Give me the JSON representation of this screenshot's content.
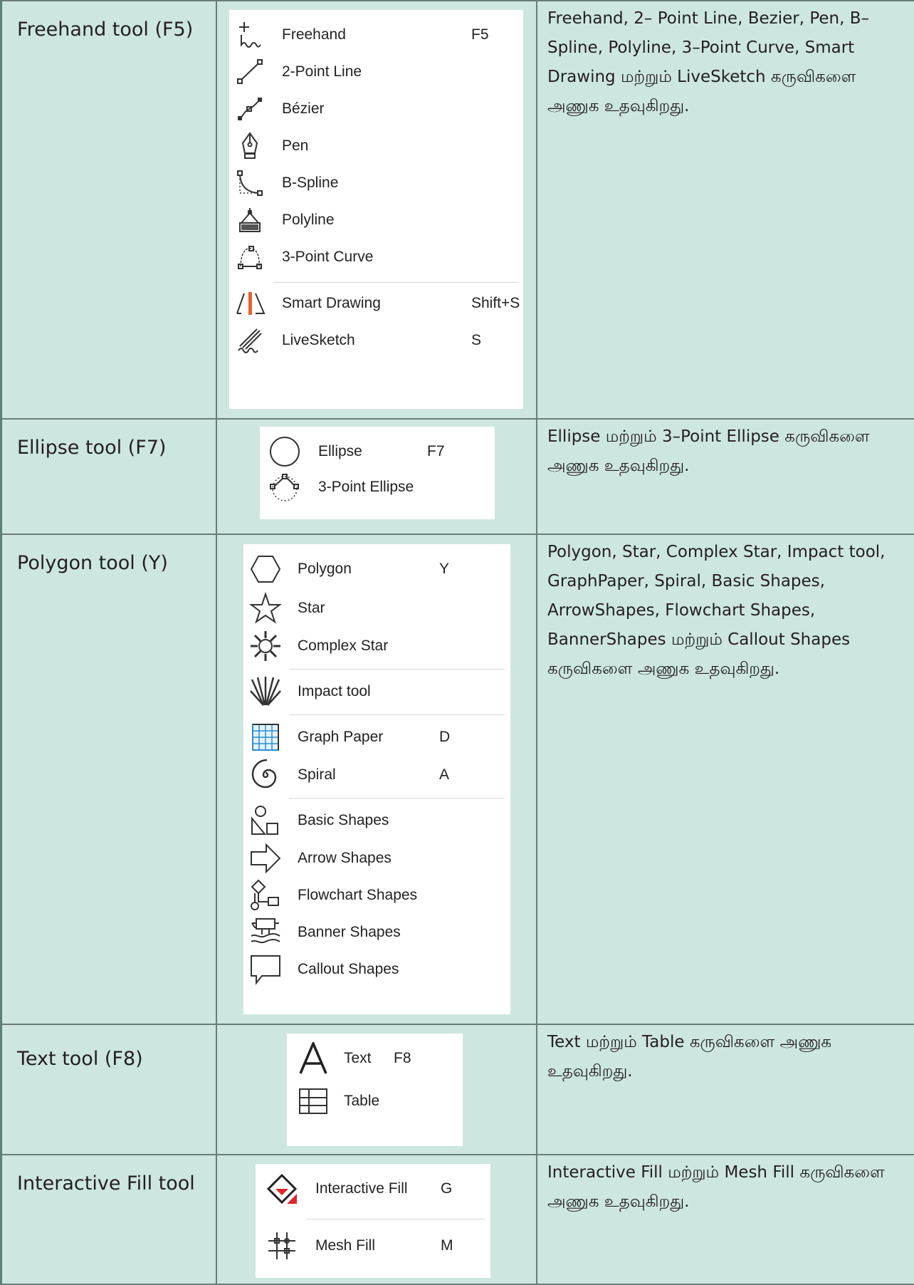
{
  "rows": [
    {
      "tool": "Freehand tool (F5)",
      "description": "Freehand, 2– Point Line, Bezier, Pen, B–Spline, Polyline, 3–Point Curve, Smart Drawing மற்றும் LiveSketch கருவிகளை அணுக உதவுகிறது.",
      "menu": [
        {
          "icon": "freehand-icon",
          "label": "Freehand",
          "shortcut": "F5"
        },
        {
          "icon": "two-point-line-icon",
          "label": "2-Point Line",
          "shortcut": ""
        },
        {
          "icon": "bezier-icon",
          "label": "Bézier",
          "shortcut": ""
        },
        {
          "icon": "pen-icon",
          "label": "Pen",
          "shortcut": ""
        },
        {
          "icon": "b-spline-icon",
          "label": "B-Spline",
          "shortcut": ""
        },
        {
          "icon": "polyline-icon",
          "label": "Polyline",
          "shortcut": ""
        },
        {
          "icon": "three-point-curve-icon",
          "label": "3-Point Curve",
          "shortcut": ""
        },
        {
          "icon": "smart-drawing-icon",
          "label": "Smart Drawing",
          "shortcut": "Shift+S"
        },
        {
          "icon": "livesketch-icon",
          "label": "LiveSketch",
          "shortcut": "S"
        }
      ]
    },
    {
      "tool": "Ellipse tool (F7)",
      "description": "Ellipse மற்றும் 3–Point Ellipse கருவிகளை அணுக உதவுகிறது.",
      "menu": [
        {
          "icon": "ellipse-icon",
          "label": "Ellipse",
          "shortcut": "F7"
        },
        {
          "icon": "three-point-ellipse-icon",
          "label": "3-Point Ellipse",
          "shortcut": ""
        }
      ]
    },
    {
      "tool": "Polygon tool (Y)",
      "description": "Polygon, Star, Complex Star, Impact tool, GraphPaper, Spiral, Basic Shapes, ArrowShapes, Flowchart Shapes, BannerShapes மற்றும் Callout Shapes கருவிகளை அணுக உதவுகிறது.",
      "menu": [
        {
          "icon": "polygon-icon",
          "label": "Polygon",
          "shortcut": "Y"
        },
        {
          "icon": "star-icon",
          "label": "Star",
          "shortcut": ""
        },
        {
          "icon": "complex-star-icon",
          "label": "Complex Star",
          "shortcut": ""
        },
        {
          "icon": "impact-tool-icon",
          "label": "Impact tool",
          "shortcut": ""
        },
        {
          "icon": "graph-paper-icon",
          "label": "Graph Paper",
          "shortcut": "D"
        },
        {
          "icon": "spiral-icon",
          "label": "Spiral",
          "shortcut": "A"
        },
        {
          "icon": "basic-shapes-icon",
          "label": "Basic Shapes",
          "shortcut": ""
        },
        {
          "icon": "arrow-shapes-icon",
          "label": "Arrow Shapes",
          "shortcut": ""
        },
        {
          "icon": "flowchart-shapes-icon",
          "label": "Flowchart Shapes",
          "shortcut": ""
        },
        {
          "icon": "banner-shapes-icon",
          "label": "Banner Shapes",
          "shortcut": ""
        },
        {
          "icon": "callout-shapes-icon",
          "label": "Callout Shapes",
          "shortcut": ""
        }
      ]
    },
    {
      "tool": "Text tool (F8)",
      "description": "Text மற்றும் Table கருவிகளை அணுக உதவுகிறது.",
      "menu": [
        {
          "icon": "text-icon",
          "label": "Text",
          "shortcut": "F8"
        },
        {
          "icon": "table-icon",
          "label": "Table",
          "shortcut": ""
        }
      ]
    },
    {
      "tool": "Interactive Fill tool",
      "description": "Interactive Fill மற்றும் Mesh Fill கருவிகளை அணுக உதவுகிறது.",
      "menu": [
        {
          "icon": "interactive-fill-icon",
          "label": "Interactive Fill",
          "shortcut": "G"
        },
        {
          "icon": "mesh-fill-icon",
          "label": "Mesh Fill",
          "shortcut": "M"
        }
      ]
    }
  ],
  "colors": {
    "background": "#cde6e0",
    "border": "#6a7d78",
    "left_rule": "#2c8b7d",
    "smart_drawing_accent": "#e8622c",
    "graph_paper_accent": "#2b8ed6",
    "interactive_fill_accent": "#e0262e"
  }
}
